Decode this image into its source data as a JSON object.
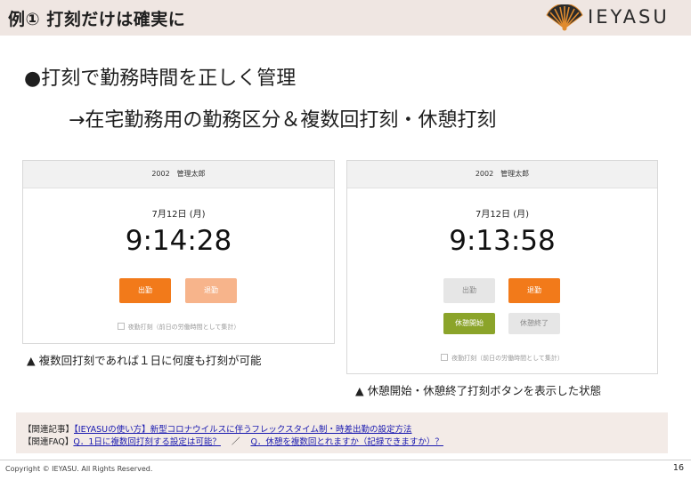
{
  "header": {
    "title": "例① 打刻だけは確実に",
    "logo_text": "IEYASU"
  },
  "heading": {
    "main": "●打刻で勤務時間を正しく管理",
    "sub": "→在宅勤務用の勤務区分＆複数回打刻・休憩打刻"
  },
  "left_panel": {
    "employee": "2002　管理太郎",
    "date": "7月12日 (月)",
    "time": "9:14:28",
    "clock_in_label": "出勤",
    "clock_out_label": "退勤",
    "night_label": "夜勤打刻（前日の労働時間として集計）"
  },
  "right_panel": {
    "employee": "2002　管理太郎",
    "date": "7月12日 (月)",
    "time": "9:13:58",
    "clock_in_label": "出勤",
    "clock_out_label": "退勤",
    "break_start_label": "休憩開始",
    "break_end_label": "休憩終了",
    "night_label": "夜勤打刻（前日の労働時間として集計）"
  },
  "captions": {
    "left": "▲ 複数回打刻であれば１日に何度も打刻が可能",
    "right": "▲ 休憩開始・休憩終了打刻ボタンを表示した状態"
  },
  "related": {
    "article_prefix": "【関連記事】",
    "article_link": "【IEYASUの使い方】新型コロナウイルスに伴うフレックスタイム制・時差出勤の設定方法",
    "faq_prefix": "【関連FAQ】",
    "faq_link_1": "Q．1日に複数回打刻する設定は可能？",
    "faq_separator": "／",
    "faq_link_2": "Q．休憩を複数回とれますか（記録できますか）？"
  },
  "footer": {
    "copyright": "Copyright © IEYASU. All Rights Reserved.",
    "page_number": "16"
  },
  "colors": {
    "header_bg": "#efe6e2",
    "orange": "#f27a1a",
    "orange_light": "#f7b48b",
    "green": "#8ba42a",
    "link": "#1a1ab0"
  },
  "icons": {
    "logo": "folding-fan-icon",
    "checkbox": "checkbox-icon"
  }
}
